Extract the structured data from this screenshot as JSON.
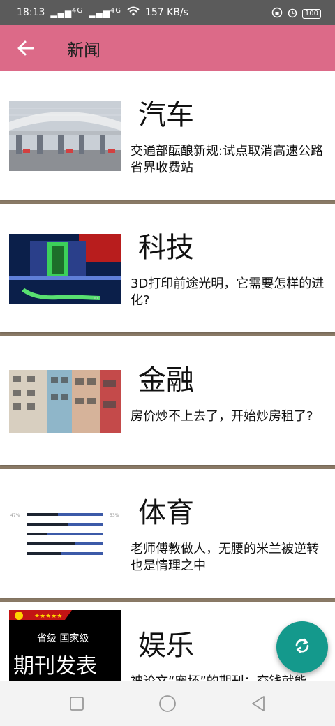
{
  "status": {
    "time": "18:13",
    "signal1": "4G",
    "signal2": "4G",
    "speed": "157 KB/s",
    "battery": "100"
  },
  "app": {
    "title": "新闻",
    "back_icon": "arrow-left-icon"
  },
  "news": [
    {
      "category": "汽车",
      "headline": "交通部酝酿新规:试点取消高速公路省界收费站"
    },
    {
      "category": "科技",
      "headline": "3D打印前途光明，它需要怎样的进化?"
    },
    {
      "category": "金融",
      "headline": "房价炒不上去了，开始炒房租了?"
    },
    {
      "category": "体育",
      "headline": "老师傅教做人，无腰的米兰被逆转也是情理之中"
    },
    {
      "category": "娱乐",
      "headline": "被论文“宠坏”的期刊：交钱就能"
    }
  ],
  "thumb_text": {
    "sports_left": "47%",
    "sports_right": "53%",
    "ent_line1": "省级  国家级",
    "ent_line2": "期刊发表"
  },
  "colors": {
    "app_bar": "#dc6a88",
    "fab": "#14998c",
    "status_bar": "#5b5b5b"
  },
  "fab": {
    "icon": "refresh-icon"
  }
}
